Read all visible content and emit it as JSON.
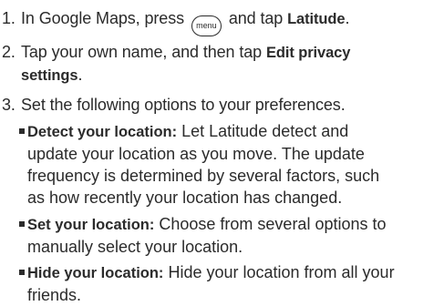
{
  "steps": [
    {
      "number": "1.",
      "text_before": "In Google Maps, press",
      "key_label": "menu",
      "text_middle": "and tap",
      "bold": "Latitude",
      "text_after": "."
    },
    {
      "number": "2.",
      "text_before": "Tap your own name, and then tap",
      "bold_line1": "Edit privacy",
      "bold_line2": "settings",
      "text_after": "."
    },
    {
      "number": "3.",
      "text": "Set the following options to your preferences."
    }
  ],
  "options": [
    {
      "title": "Detect your location:",
      "line1": "Let Latitude detect and",
      "line2": "update your location as you move. The update",
      "line3": "frequency is determined by several factors, such",
      "line4": "as how recently your location has changed."
    },
    {
      "title": "Set your location:",
      "line1": "Choose from several options to",
      "line2": "manually select your location."
    },
    {
      "title": "Hide your location:",
      "line1": "Hide your location from all your",
      "line2": "friends."
    }
  ]
}
